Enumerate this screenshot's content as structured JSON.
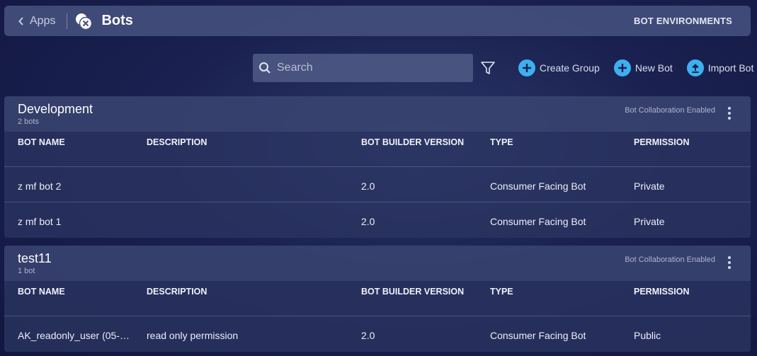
{
  "header": {
    "back_label": "Apps",
    "title": "Bots",
    "environments_label": "BOT ENVIRONMENTS"
  },
  "toolbar": {
    "search_placeholder": "Search",
    "create_group_label": "Create Group",
    "new_bot_label": "New Bot",
    "import_bot_label": "Import Bot"
  },
  "columns": {
    "name": "BOT NAME",
    "description": "DESCRIPTION",
    "version": "BOT BUILDER VERSION",
    "type": "TYPE",
    "permission": "PERMISSION"
  },
  "groups": [
    {
      "name": "Development",
      "count": "2 bots",
      "collaboration": "Bot Collaboration Enabled",
      "rows": [
        {
          "name": "z mf bot 2",
          "description": "",
          "version": "2.0",
          "type": "Consumer Facing Bot",
          "permission": "Private"
        },
        {
          "name": "z mf bot 1",
          "description": "",
          "version": "2.0",
          "type": "Consumer Facing Bot",
          "permission": "Private"
        }
      ]
    },
    {
      "name": "test11",
      "count": "1 bot",
      "collaboration": "Bot Collaboration Enabled",
      "rows": [
        {
          "name": "AK_readonly_user (05-…",
          "description": "read only permission",
          "version": "2.0",
          "type": "Consumer Facing Bot",
          "permission": "Public"
        }
      ]
    }
  ],
  "colors": {
    "accent": "#3db0f0",
    "topbar": "#485280",
    "background": "#1a2150"
  },
  "icons": {
    "back": "chevron-left-icon",
    "logo": "bots-logo-icon",
    "search": "search-icon",
    "filter": "filter-icon",
    "create_group": "plus-circle-icon",
    "new_bot": "plus-circle-icon",
    "import_bot": "upload-circle-icon",
    "menu": "kebab-menu-icon"
  }
}
